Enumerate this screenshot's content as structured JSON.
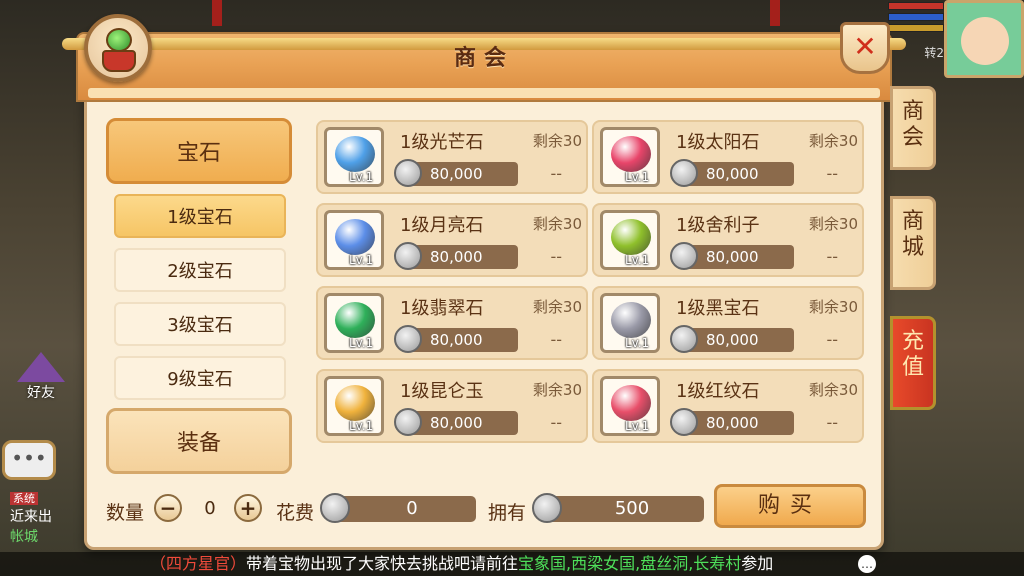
{
  "panel": {
    "title": "商会",
    "close_label": "✕"
  },
  "categories": [
    {
      "label": "宝石",
      "active": true
    }
  ],
  "sub_categories": [
    {
      "label": "1级宝石",
      "active": true
    },
    {
      "label": "2级宝石",
      "active": false
    },
    {
      "label": "3级宝石",
      "active": false
    },
    {
      "label": "9级宝石",
      "active": false
    }
  ],
  "category_equip": {
    "label": "装备"
  },
  "items": [
    {
      "name": "1级光芒石",
      "remain": "剩余30",
      "price": "80,000",
      "level": "Lv.1",
      "dash": "--",
      "color": "#4fa0e8"
    },
    {
      "name": "1级太阳石",
      "remain": "剩余30",
      "price": "80,000",
      "level": "Lv.1",
      "dash": "--",
      "color": "#e8456a"
    },
    {
      "name": "1级月亮石",
      "remain": "剩余30",
      "price": "80,000",
      "level": "Lv.1",
      "dash": "--",
      "color": "#5c8ee8"
    },
    {
      "name": "1级舍利子",
      "remain": "剩余30",
      "price": "80,000",
      "level": "Lv.1",
      "dash": "--",
      "color": "#8fc02b"
    },
    {
      "name": "1级翡翠石",
      "remain": "剩余30",
      "price": "80,000",
      "level": "Lv.1",
      "dash": "--",
      "color": "#2fb05a"
    },
    {
      "name": "1级黑宝石",
      "remain": "剩余30",
      "price": "80,000",
      "level": "Lv.1",
      "dash": "--",
      "color": "#9a9aa8"
    },
    {
      "name": "1级昆仑玉",
      "remain": "剩余30",
      "price": "80,000",
      "level": "Lv.1",
      "dash": "--",
      "color": "#f0b23c"
    },
    {
      "name": "1级红纹石",
      "remain": "剩余30",
      "price": "80,000",
      "level": "Lv.1",
      "dash": "--",
      "color": "#e84f6a"
    }
  ],
  "side_tabs": [
    {
      "label": "商\n会"
    },
    {
      "label": "商\n城"
    },
    {
      "label": "充\n值"
    }
  ],
  "bottom": {
    "qty_label": "数量",
    "minus": "−",
    "qty_value": "0",
    "plus": "+",
    "cost_label": "花费",
    "cost_value": "0",
    "own_label": "拥有",
    "own_value": "500",
    "buy_label": "购买"
  },
  "background": {
    "friend_label": "好友",
    "chat_dots": "•••",
    "left_chat_tag": "系统",
    "left_chat_line1": "近来出",
    "left_chat_line2": "帐城",
    "zhuan_label": "转2"
  },
  "ticker": {
    "prefix": "（四方星官）",
    "body": "带着宝物出现了大家快去挑战吧请前往",
    "places": "宝象国,西梁女国,盘丝洞,长寿村",
    "suffix": "参加"
  }
}
